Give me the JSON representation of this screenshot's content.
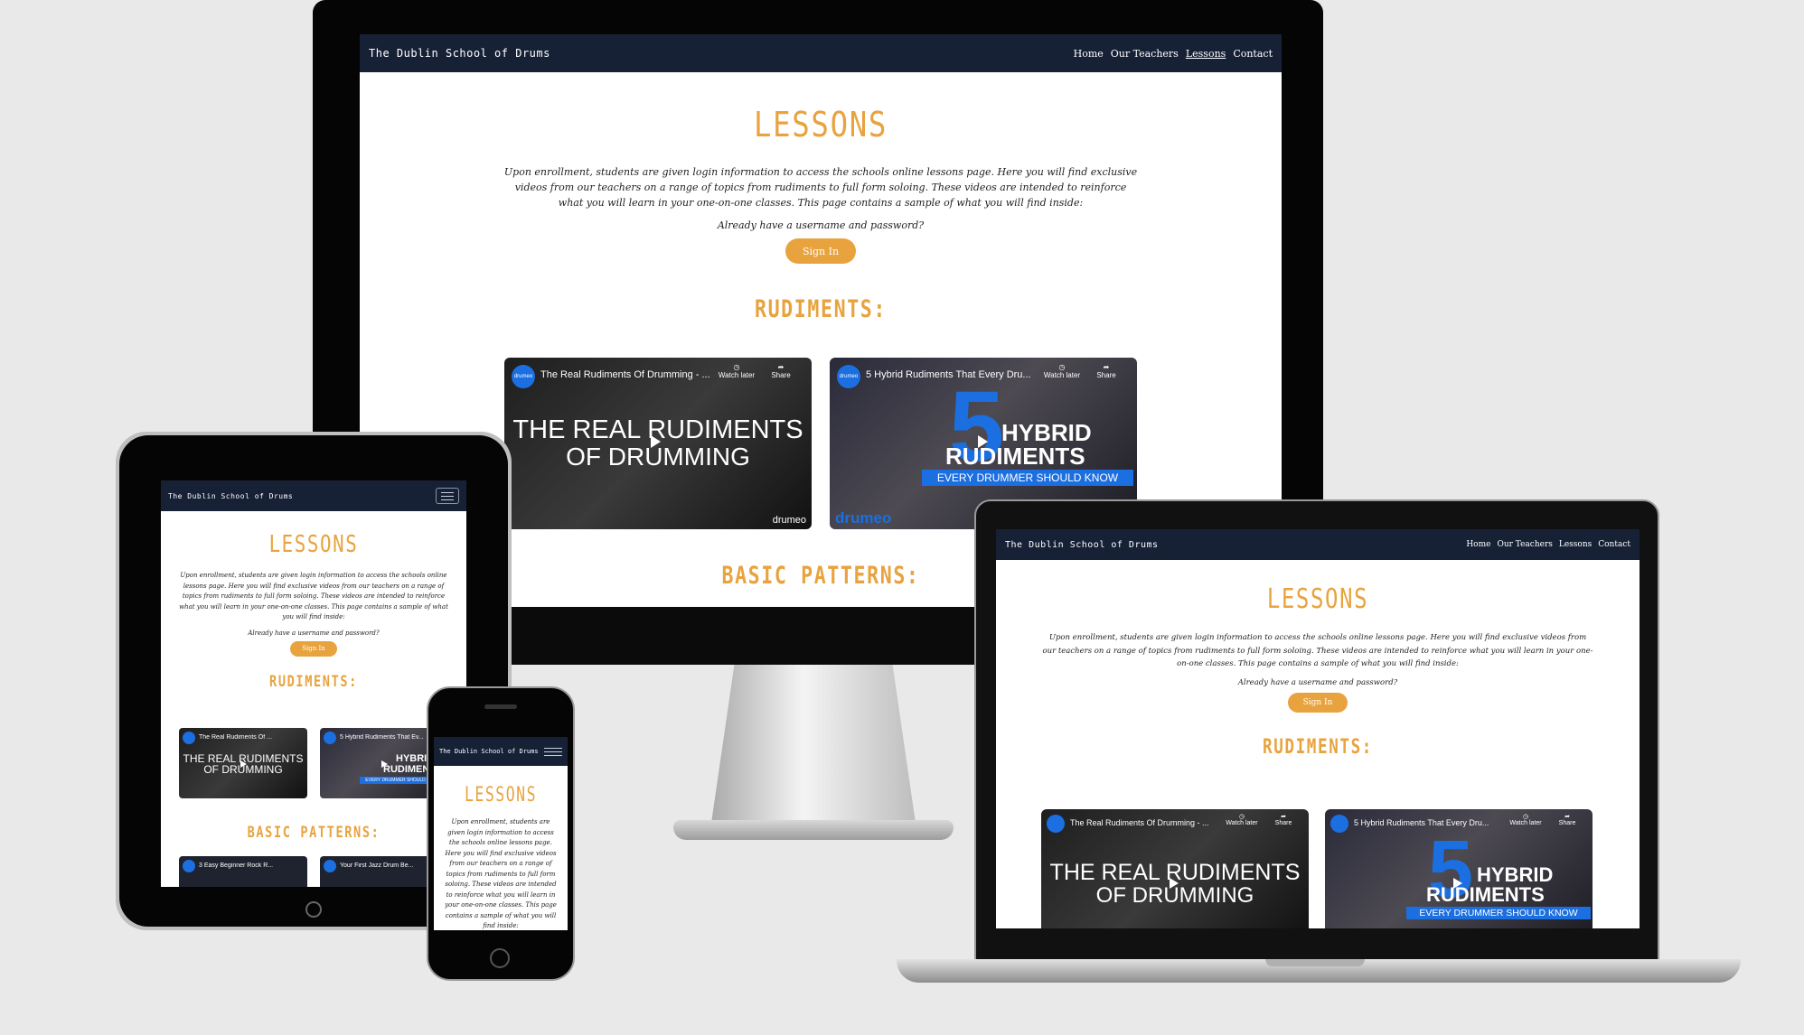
{
  "site": {
    "brand": "The Dublin School of Drums",
    "nav": [
      "Home",
      "Our Teachers",
      "Lessons",
      "Contact"
    ],
    "heading": "LESSONS",
    "intro": "Upon enrollment, students are given login information to access the schools online lessons page. Here you will find exclusive videos from our teachers on a range of topics from rudiments to full form soloing. These videos are intended to reinforce what you will learn in your one-on-one classes. This page contains a sample of what you will find inside:",
    "question": "Already have a username and password?",
    "signin": "Sign In",
    "rudiments": "RUDIMENTS:",
    "patterns": "BASIC PATTERNS:"
  },
  "videos": {
    "v1_title": "The Real Rudiments Of Drumming - ...",
    "v1_line1": "THE REAL RUDIMENTS",
    "v1_line2": "OF DRUMMING",
    "v2_title": "5 Hybrid Rudiments That Every Dru...",
    "v2_line1": "HYBRID",
    "v2_line2": "RUDIMENTS",
    "v2_band": "EVERY DRUMMER SHOULD KNOW",
    "v2_num": "5",
    "watch_later": "Watch later",
    "share": "Share",
    "logo": "drumeo",
    "tab_v1_title": "The Real Rudiments Of ...",
    "tab_v2_title": "5 Hybrid Rudiments That Ev...",
    "tab_v3_title": "3 Easy Beginner Rock R...",
    "tab_v4_title": "Your First Jazz Drum Be..."
  },
  "colors": {
    "nav": "#172136",
    "accent": "#e8a33e",
    "drumeo_blue": "#1b6fe0"
  }
}
